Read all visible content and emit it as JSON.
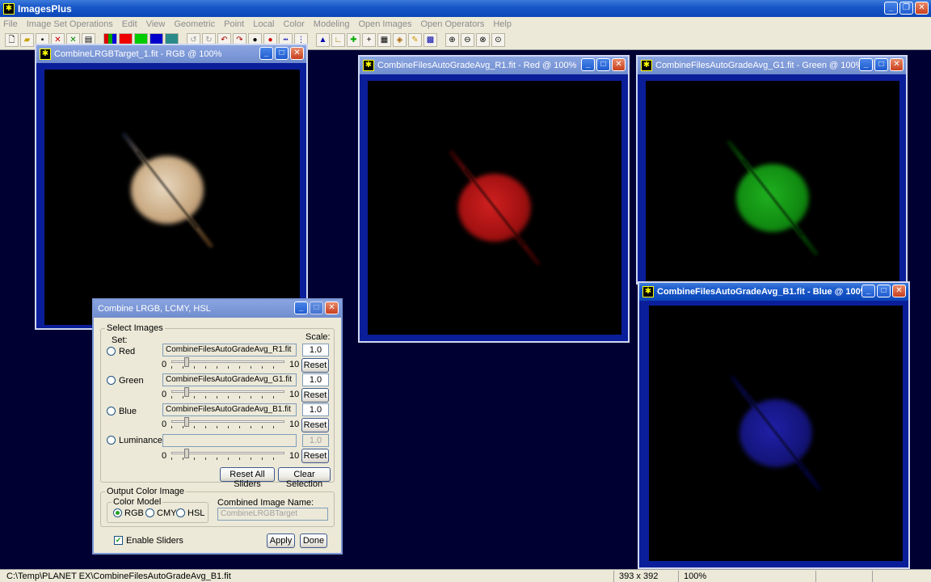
{
  "app": {
    "title": "ImagesPlus"
  },
  "menu": [
    "File",
    "Image Set Operations",
    "Edit",
    "View",
    "Geometric",
    "Point",
    "Local",
    "Color",
    "Modeling",
    "Open Images",
    "Open Operators",
    "Help"
  ],
  "windows": {
    "rgb": {
      "title": "CombineLRGBTarget_1.fit - RGB @ 100%"
    },
    "red": {
      "title": "CombineFilesAutoGradeAvg_R1.fit - Red @ 100%"
    },
    "green": {
      "title": "CombineFilesAutoGradeAvg_G1.fit - Green @ 100%"
    },
    "blue": {
      "title": "CombineFilesAutoGradeAvg_B1.fit - Blue @ 100%"
    }
  },
  "dialog": {
    "title": "Combine LRGB, LCMY, HSL",
    "select_images_label": "Select Images",
    "set_label": "Set:",
    "scale_label": "Scale:",
    "rows": [
      {
        "label": "Red",
        "file": "CombineFilesAutoGradeAvg_R1.fit",
        "scale": "1.0",
        "min": "0",
        "max": "10",
        "reset": "Reset",
        "enabled": true
      },
      {
        "label": "Green",
        "file": "CombineFilesAutoGradeAvg_G1.fit",
        "scale": "1.0",
        "min": "0",
        "max": "10",
        "reset": "Reset",
        "enabled": true
      },
      {
        "label": "Blue",
        "file": "CombineFilesAutoGradeAvg_B1.fit",
        "scale": "1.0",
        "min": "0",
        "max": "10",
        "reset": "Reset",
        "enabled": true
      },
      {
        "label": "Luminance",
        "file": "",
        "scale": "1.0",
        "min": "0",
        "max": "10",
        "reset": "Reset",
        "enabled": false
      }
    ],
    "reset_all_label": "Reset All Sliders",
    "clear_selection_label": "Clear Selection",
    "output_label": "Output Color Image",
    "color_model_label": "Color Model",
    "models": [
      "RGB",
      "CMY",
      "HSL"
    ],
    "selected_model": "RGB",
    "combined_name_label": "Combined Image Name:",
    "combined_name_placeholder": "CombineLRGBTarget",
    "enable_sliders_label": "Enable Sliders",
    "enable_sliders_checked": true,
    "apply_label": "Apply",
    "done_label": "Done"
  },
  "status": {
    "path": "C:\\Temp\\PLANET EX\\CombineFilesAutoGradeAvg_B1.fit",
    "dimensions": "393 x 392",
    "zoom": "100%"
  }
}
